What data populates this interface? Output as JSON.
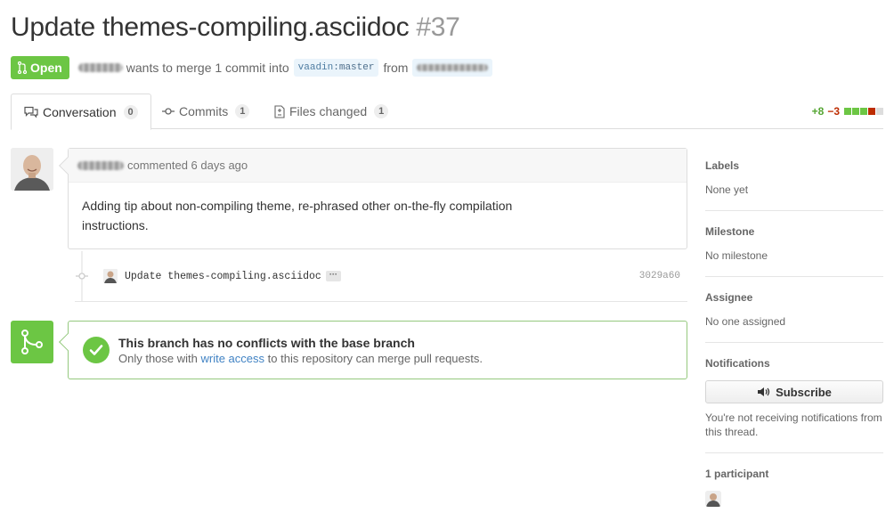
{
  "pr": {
    "title": "Update themes-compiling.asciidoc",
    "number": "#37",
    "state": "Open",
    "merge_text": "wants to merge 1 commit into",
    "base_repo": "vaadin",
    "base_branch": "master",
    "from_text": "from"
  },
  "tabs": [
    {
      "label": "Conversation",
      "count": "0"
    },
    {
      "label": "Commits",
      "count": "1"
    },
    {
      "label": "Files changed",
      "count": "1"
    }
  ],
  "diffstat": {
    "additions": "+8",
    "deletions": "−3"
  },
  "comment": {
    "action": "commented 6 days ago",
    "body": "Adding tip about non-compiling theme, re-phrased other on-the-fly compilation instructions."
  },
  "commit": {
    "message": "Update themes-compiling.asciidoc",
    "ellipsis": "···",
    "sha": "3029a60"
  },
  "merge": {
    "title": "This branch has no conflicts with the base branch",
    "sub_prefix": "Only those with",
    "sub_link": "write access",
    "sub_suffix": "to this repository can merge pull requests."
  },
  "sidebar": {
    "labels_heading": "Labels",
    "labels_value": "None yet",
    "milestone_heading": "Milestone",
    "milestone_value": "No milestone",
    "assignee_heading": "Assignee",
    "assignee_value": "No one assigned",
    "notifications_heading": "Notifications",
    "subscribe_label": "Subscribe",
    "notifications_text": "You're not receiving notifications from this thread.",
    "participants_heading": "1 participant"
  },
  "colors": {
    "open_green": "#6cc644",
    "add_green": "#55a532",
    "del_red": "#bd2c00",
    "link_blue": "#4183c4"
  },
  "icons": [
    "git-pull-request-icon",
    "comment-discussion-icon",
    "git-commit-icon",
    "diff-file-icon",
    "git-merge-icon",
    "check-icon",
    "megaphone-icon"
  ]
}
